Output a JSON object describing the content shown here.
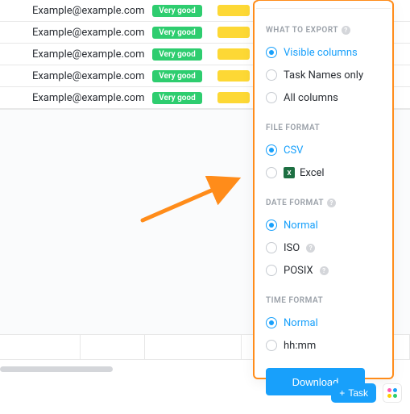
{
  "table": {
    "rows": [
      {
        "email": "Example@example.com",
        "status": "Very good"
      },
      {
        "email": "Example@example.com",
        "status": "Very good"
      },
      {
        "email": "Example@example.com",
        "status": "Very good"
      },
      {
        "email": "Example@example.com",
        "status": "Very good"
      },
      {
        "email": "Example@example.com",
        "status": "Very good"
      }
    ]
  },
  "export": {
    "sections": {
      "what": "WHAT TO EXPORT",
      "file": "FILE FORMAT",
      "date": "DATE FORMAT",
      "time": "TIME FORMAT"
    },
    "what": {
      "visible": "Visible columns",
      "taskNames": "Task Names only",
      "all": "All columns"
    },
    "file": {
      "csv": "CSV",
      "excel": "Excel"
    },
    "date": {
      "normal": "Normal",
      "iso": "ISO",
      "posix": "POSIX"
    },
    "time": {
      "normal": "Normal",
      "hhmm": "hh:mm"
    },
    "download": "Download"
  },
  "bottom": {
    "task": "Task"
  }
}
